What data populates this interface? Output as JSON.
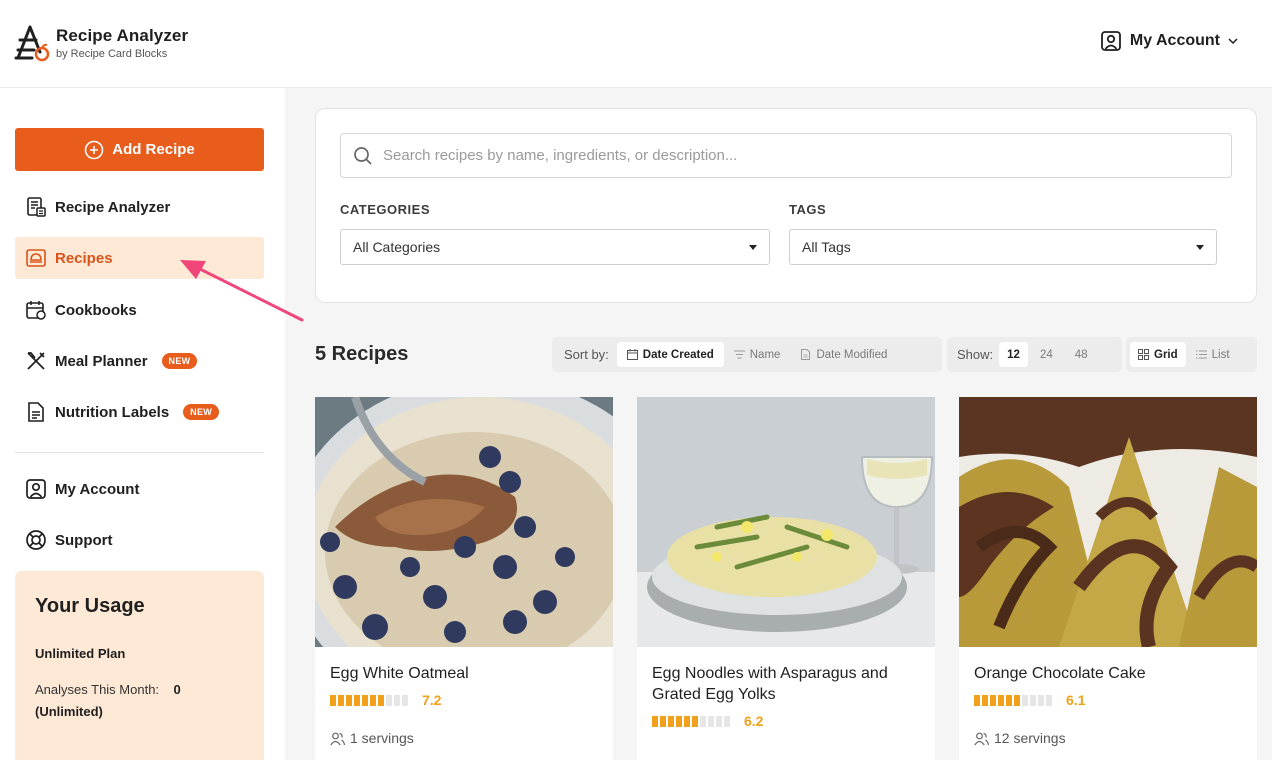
{
  "app": {
    "title": "Recipe Analyzer",
    "subtitle": "by Recipe Card Blocks"
  },
  "header": {
    "account_label": "My Account"
  },
  "sidebar": {
    "add_label": "Add Recipe",
    "items": [
      {
        "label": "Recipe Analyzer",
        "icon": "calculator-icon"
      },
      {
        "label": "Recipes",
        "icon": "recipe-icon",
        "active": true
      },
      {
        "label": "Cookbooks",
        "icon": "cookbook-icon"
      },
      {
        "label": "Meal Planner",
        "icon": "utensils-icon",
        "badge": "NEW"
      },
      {
        "label": "Nutrition Labels",
        "icon": "document-icon",
        "badge": "NEW"
      },
      {
        "label": "My Account",
        "icon": "user-icon"
      },
      {
        "label": "Support",
        "icon": "lifebuoy-icon"
      }
    ],
    "usage": {
      "title": "Your Usage",
      "plan": "Unlimited Plan",
      "analyses_label": "Analyses This Month:",
      "analyses_value": "0",
      "analyses_note": "(Unlimited)"
    }
  },
  "filters": {
    "search_placeholder": "Search recipes by name, ingredients, or description...",
    "categories_label": "CATEGORIES",
    "categories_value": "All Categories",
    "tags_label": "TAGS",
    "tags_value": "All Tags"
  },
  "list": {
    "count_title": "5 Recipes",
    "sort_label": "Sort by:",
    "sort_options": [
      "Date Created",
      "Name",
      "Date Modified"
    ],
    "sort_selected": "Date Created",
    "show_label": "Show:",
    "show_options": [
      "12",
      "24",
      "48"
    ],
    "show_selected": "12",
    "view_options": [
      "Grid",
      "List"
    ],
    "view_selected": "Grid"
  },
  "recipes": [
    {
      "title": "Egg White Oatmeal",
      "score": "7.2",
      "score_value": 7.2,
      "servings": "1 servings"
    },
    {
      "title": "Egg Noodles with Asparagus and Grated Egg Yolks",
      "score": "6.2",
      "score_value": 6.2,
      "servings": ""
    },
    {
      "title": "Orange Chocolate Cake",
      "score": "6.1",
      "score_value": 6.1,
      "servings": "12 servings"
    }
  ],
  "colors": {
    "accent": "#e85c1c",
    "active_bg": "#fde9d6",
    "rating": "#f0a01b",
    "annotation_arrow": "#f0467a"
  }
}
